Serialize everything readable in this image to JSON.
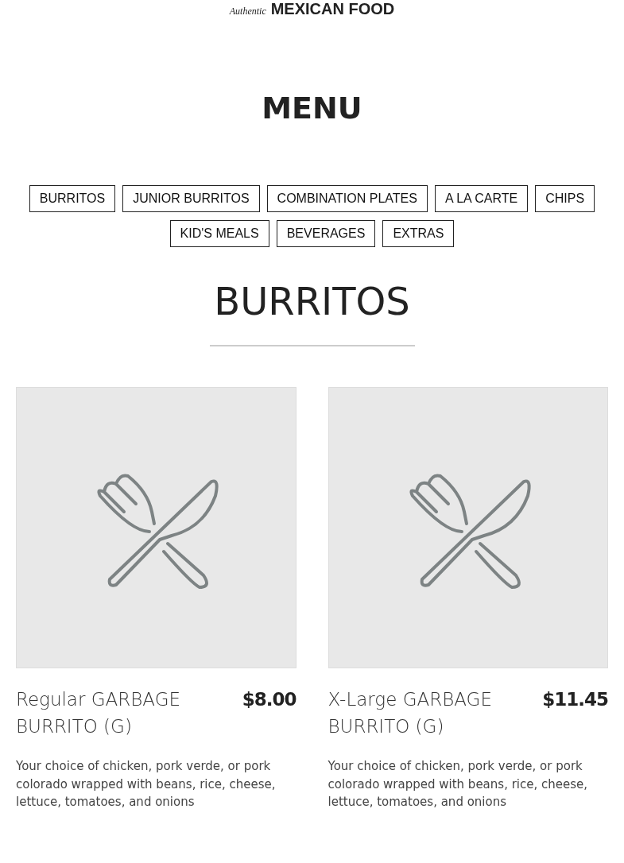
{
  "logo": {
    "script": "Authentic",
    "name": "MEXICAN FOOD"
  },
  "title": "MENU",
  "categories": [
    {
      "label": "BURRITOS"
    },
    {
      "label": "JUNIOR BURRITOS"
    },
    {
      "label": "COMBINATION PLATES"
    },
    {
      "label": "A LA CARTE"
    },
    {
      "label": "CHIPS"
    },
    {
      "label": "KID'S MEALS"
    },
    {
      "label": "BEVERAGES"
    },
    {
      "label": "EXTRAS"
    }
  ],
  "section": {
    "heading": "BURRITOS",
    "items": [
      {
        "name": "Regular GARBAGE BURRITO (G)",
        "price": "$8.00",
        "description": "Your choice of chicken, pork verde, or pork colorado wrapped with beans, rice, cheese, lettuce, tomatoes, and onions"
      },
      {
        "name": "X-Large GARBAGE BURRITO (G)",
        "price": "$11.45",
        "description": "Your choice of chicken, pork verde, or pork colorado wrapped with beans, rice, cheese, lettuce, tomatoes, and onions"
      }
    ]
  }
}
